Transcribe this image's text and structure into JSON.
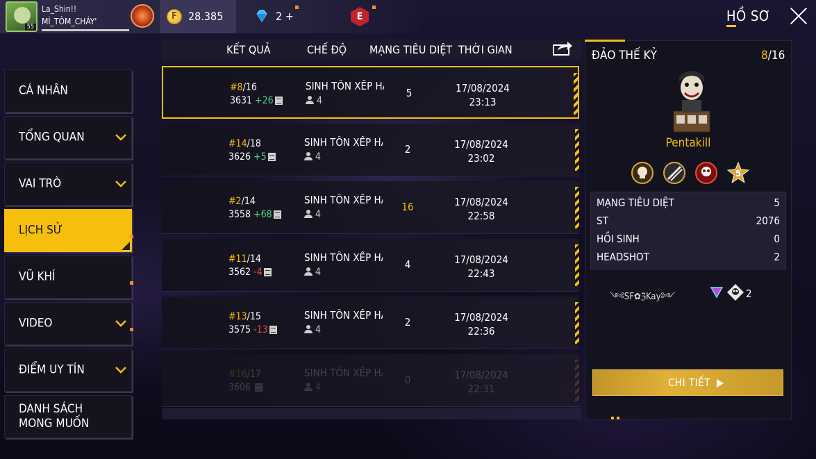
{
  "player": {
    "name": "La_Shin!!",
    "guild": "MÌ_TÔM_CHÁY'",
    "level": "55"
  },
  "currency": {
    "gold": "28.385",
    "diamonds": "2"
  },
  "header": {
    "title": "HỒ SƠ"
  },
  "sidebar": {
    "items": [
      {
        "label": "CÁ NHÂN",
        "chevron": false
      },
      {
        "label": "TỔNG QUAN",
        "chevron": true
      },
      {
        "label": "VAI TRÒ",
        "chevron": true
      },
      {
        "label": "LỊCH SỬ",
        "chevron": false,
        "active": true
      },
      {
        "label": "VŨ KHÍ",
        "chevron": false
      },
      {
        "label": "VIDEO",
        "chevron": true
      },
      {
        "label": "ĐIỂM UY TÍN",
        "chevron": true
      },
      {
        "label": "DANH SÁCH\nMONG MUỐN",
        "chevron": false
      }
    ]
  },
  "table": {
    "columns": [
      "KẾT QUẢ",
      "CHẾ ĐỘ",
      "MẠNG TIÊU DIỆT",
      "THỜI GIAN"
    ],
    "rows": [
      {
        "rank": "#8",
        "total": "/16",
        "points": "3631",
        "delta": "+26",
        "delta_sign": "pos",
        "mode": "SINH TỒN XẾP HẠNG",
        "squad": "4",
        "kills": "5",
        "date": "17/08/2024",
        "time": "23:13"
      },
      {
        "rank": "#14",
        "total": "/18",
        "points": "3626",
        "delta": "+5",
        "delta_sign": "pos",
        "mode": "SINH TỒN XẾP HẠNG",
        "squad": "4",
        "kills": "2",
        "date": "17/08/2024",
        "time": "23:02"
      },
      {
        "rank": "#2",
        "total": "/14",
        "points": "3558",
        "delta": "+68",
        "delta_sign": "pos",
        "mode": "SINH TỒN XẾP HẠNG",
        "squad": "4",
        "kills": "16",
        "date": "17/08/2024",
        "time": "22:58"
      },
      {
        "rank": "#11",
        "total": "/14",
        "points": "3562",
        "delta": "-4",
        "delta_sign": "neg",
        "mode": "SINH TỒN XẾP HẠNG",
        "squad": "4",
        "kills": "4",
        "date": "17/08/2024",
        "time": "22:43"
      },
      {
        "rank": "#13",
        "total": "/15",
        "points": "3575",
        "delta": "-13",
        "delta_sign": "neg",
        "mode": "SINH TỒN XẾP HẠNG",
        "squad": "4",
        "kills": "2",
        "date": "17/08/2024",
        "time": "22:36"
      },
      {
        "rank": "#16",
        "total": "/17",
        "points": "3606",
        "delta": "",
        "delta_sign": "pos",
        "mode": "SINH TỒN XẾP HẠNG",
        "squad": "4",
        "kills": "0",
        "date": "17/08/2024",
        "time": "22:31"
      }
    ]
  },
  "detail": {
    "title": "ĐẢO THẾ KỶ",
    "rank": "8",
    "total": "/16",
    "award": "Pentakill",
    "stats": [
      {
        "label": "MẠNG TIÊU DIỆT",
        "value": "5"
      },
      {
        "label": "ST",
        "value": "2076"
      },
      {
        "label": "HỒI SINH",
        "value": "0"
      },
      {
        "label": "HEADSHOT",
        "value": "2"
      }
    ],
    "signature": "༺SF✿ℨKay༻",
    "skull_count": "2",
    "button": "CHI TIẾT"
  },
  "colors": {
    "accent": "#f6bf0e",
    "positive": "#4fd48c",
    "negative": "#f04a3a"
  }
}
